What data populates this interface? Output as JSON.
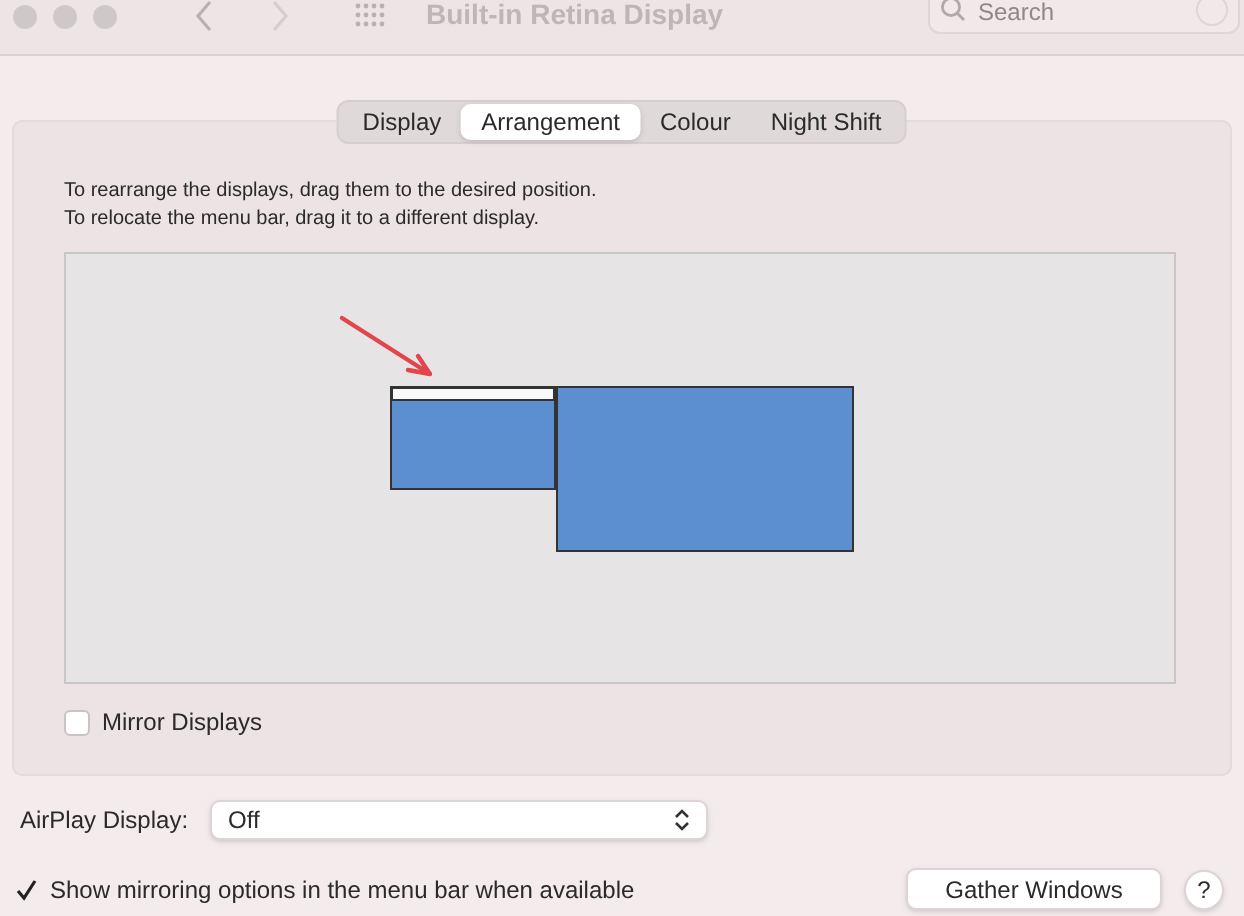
{
  "window": {
    "title": "Built-in Retina Display"
  },
  "search": {
    "placeholder": "Search"
  },
  "tabs": [
    {
      "label": "Display",
      "selected": false
    },
    {
      "label": "Arrangement",
      "selected": true
    },
    {
      "label": "Colour",
      "selected": false
    },
    {
      "label": "Night Shift",
      "selected": false
    }
  ],
  "instructions": [
    "To rearrange the displays, drag them to the desired position.",
    "To relocate the menu bar, drag it to a different display."
  ],
  "mirror": {
    "label": "Mirror Displays",
    "checked": false
  },
  "airplay": {
    "label": "AirPlay Display:",
    "value": "Off"
  },
  "show_mirroring": {
    "label": "Show mirroring options in the menu bar when available",
    "checked": true
  },
  "buttons": {
    "gather": "Gather Windows",
    "help": "?"
  }
}
